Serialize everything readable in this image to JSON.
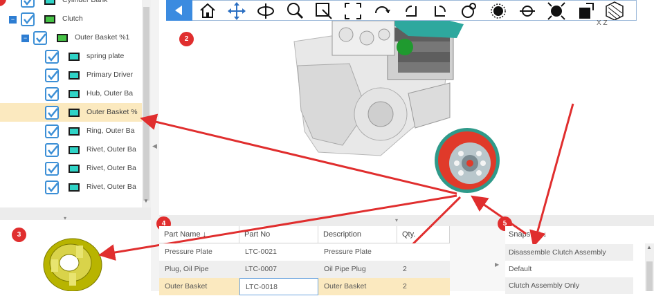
{
  "tree": {
    "items": [
      {
        "label": "Cylinder Bank",
        "type": "part"
      },
      {
        "label": "Clutch",
        "type": "assembly"
      },
      {
        "label": "Outer Basket %1",
        "type": "assembly"
      },
      {
        "label": "spring plate",
        "type": "part"
      },
      {
        "label": "Primary Driver",
        "type": "part"
      },
      {
        "label": "Hub, Outer Ba",
        "type": "part"
      },
      {
        "label": "Outer Basket %",
        "type": "part",
        "selected": true
      },
      {
        "label": "Ring, Outer Ba",
        "type": "part"
      },
      {
        "label": "Rivet, Outer Ba",
        "type": "part"
      },
      {
        "label": "Rivet, Outer Ba",
        "type": "part"
      },
      {
        "label": "Rivet, Outer Ba",
        "type": "part"
      }
    ]
  },
  "toolbar": {
    "buttons": [
      "home-icon",
      "pan-icon",
      "rotate-icon",
      "zoom-icon",
      "zoom-window-icon",
      "fit-all-icon",
      "rotate-axis-icon",
      "rotate-left-icon",
      "rotate-right-icon",
      "rotate-free-icon",
      "section-icon",
      "flip-icon",
      "explode-icon",
      "clip-icon",
      "shaded-icon"
    ],
    "axis_label": "X   Z"
  },
  "badges": {
    "b2": "2",
    "b3": "3",
    "b4": "4",
    "b5": "5"
  },
  "grid": {
    "columns": [
      "Part Name ↓",
      "Part No",
      "Description",
      "Qty."
    ],
    "rows": [
      {
        "name": "Pressure Plate",
        "part_no": "LTC-0021",
        "description": "Pressure Plate",
        "qty": ""
      },
      {
        "name": "Plug, Oil Pipe",
        "part_no": "LTC-0007",
        "description": "Oil Pipe Plug",
        "qty": "2"
      },
      {
        "name": "Outer Basket",
        "part_no": "LTC-0018",
        "description": "Outer Basket",
        "qty": "2",
        "selected": true
      }
    ]
  },
  "snapshots": {
    "header": "Snapshot ↓",
    "items": [
      "Disassemble Clutch Assembly",
      "Default",
      "Clutch Assembly Only"
    ]
  },
  "colors": {
    "accent": "#3b8be0",
    "annotation": "#e02e2e",
    "selection": "#fbe9bf",
    "part_yellow": "#c9c400",
    "clutch_red": "#e03a2a"
  }
}
